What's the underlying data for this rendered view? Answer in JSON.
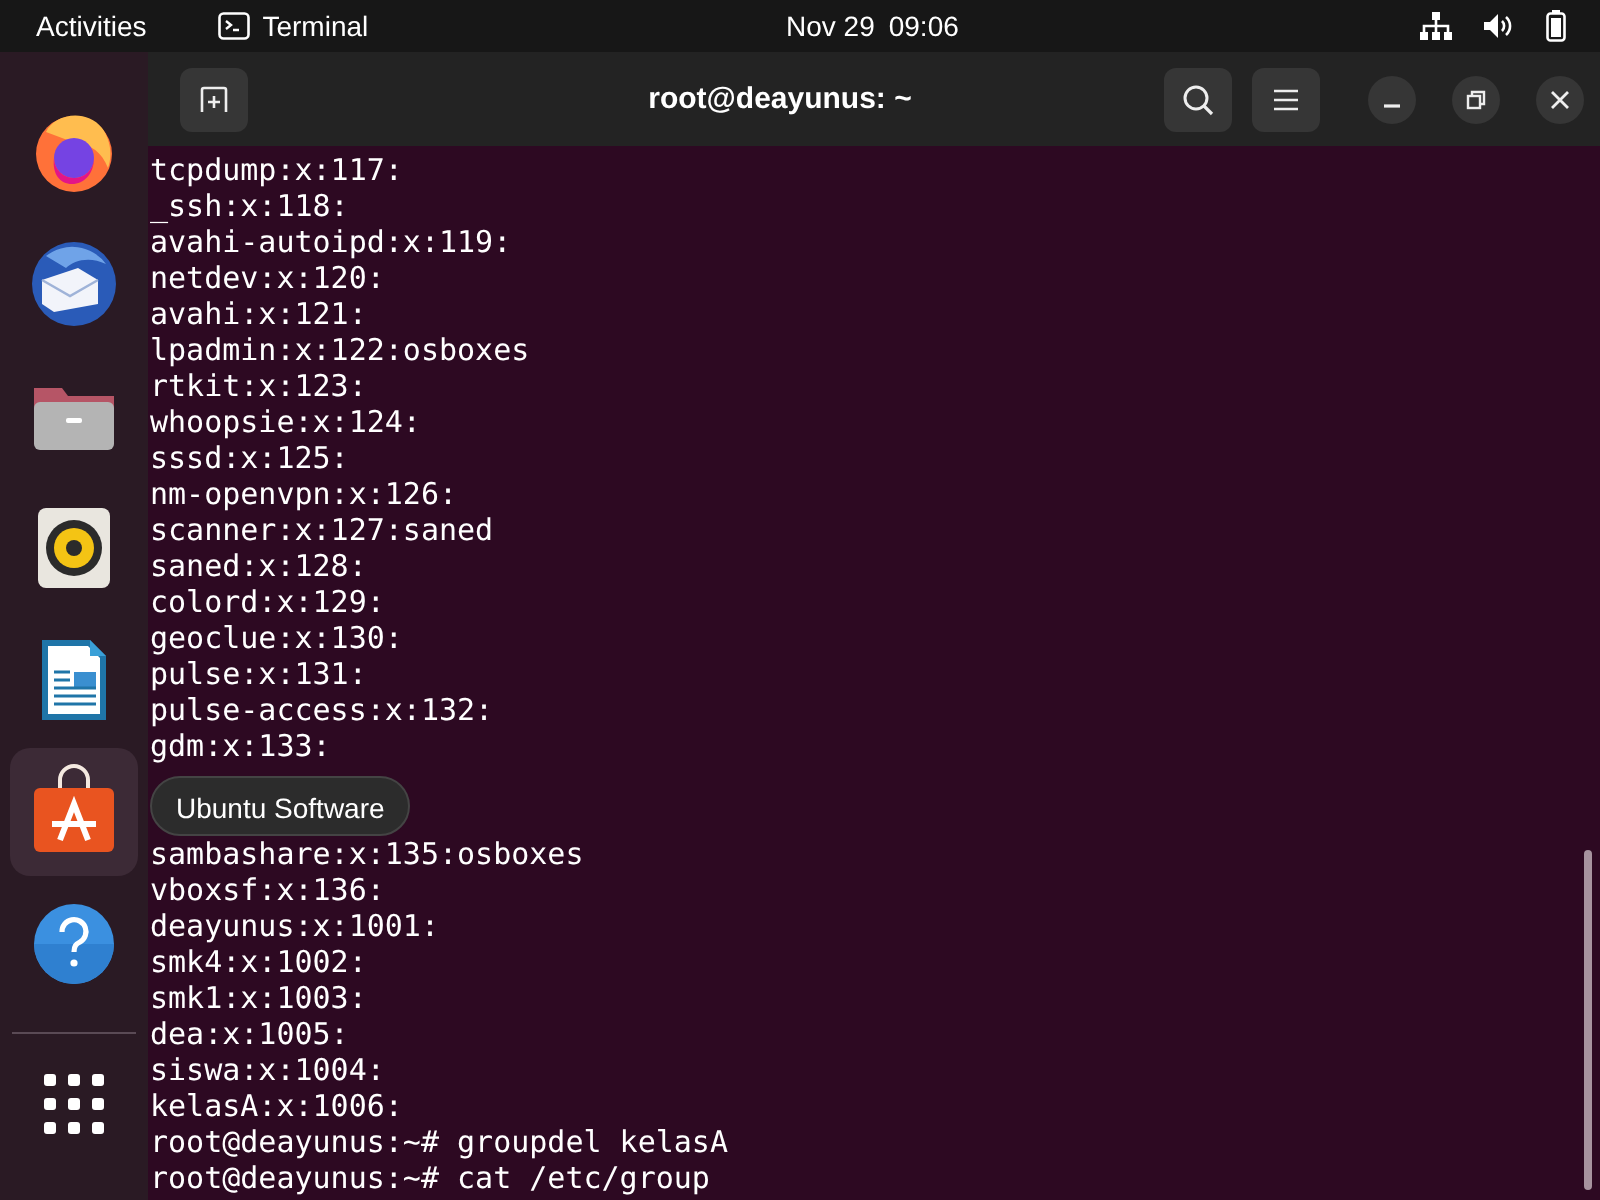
{
  "top_bar": {
    "activities": "Activities",
    "app_name": "Terminal",
    "date": "Nov 29",
    "time": "09:06"
  },
  "dock": {
    "items": [
      {
        "kind": "browser",
        "selected": false
      },
      {
        "kind": "mail",
        "selected": false
      },
      {
        "kind": "files",
        "selected": false
      },
      {
        "kind": "music",
        "selected": false
      },
      {
        "kind": "writer",
        "selected": false
      },
      {
        "kind": "store",
        "selected": true
      },
      {
        "kind": "help",
        "selected": false
      }
    ],
    "tooltip": "Ubuntu Software"
  },
  "window": {
    "title": "root@deayunus: ~"
  },
  "terminal": {
    "lines": [
      {
        "kind": "text",
        "text": "tcpdump:x:117:"
      },
      {
        "kind": "text",
        "text": "_ssh:x:118:"
      },
      {
        "kind": "text",
        "text": "avahi-autoipd:x:119:"
      },
      {
        "kind": "text",
        "text": "netdev:x:120:"
      },
      {
        "kind": "text",
        "text": "avahi:x:121:"
      },
      {
        "kind": "text",
        "text": "lpadmin:x:122:osboxes"
      },
      {
        "kind": "text",
        "text": "rtkit:x:123:"
      },
      {
        "kind": "text",
        "text": "whoopsie:x:124:"
      },
      {
        "kind": "text",
        "text": "sssd:x:125:"
      },
      {
        "kind": "text",
        "text": "nm-openvpn:x:126:"
      },
      {
        "kind": "text",
        "text": "scanner:x:127:saned"
      },
      {
        "kind": "text",
        "text": "saned:x:128:"
      },
      {
        "kind": "text",
        "text": "colord:x:129:"
      },
      {
        "kind": "text",
        "text": "geoclue:x:130:"
      },
      {
        "kind": "text",
        "text": "pulse:x:131:"
      },
      {
        "kind": "text",
        "text": "pulse-access:x:132:"
      },
      {
        "kind": "text",
        "text": "gdm:x:133:"
      },
      {
        "kind": "covered"
      },
      {
        "kind": "covered"
      },
      {
        "kind": "text",
        "text": "sambashare:x:135:osboxes"
      },
      {
        "kind": "text",
        "text": "vboxsf:x:136:"
      },
      {
        "kind": "text",
        "text": "deayunus:x:1001:"
      },
      {
        "kind": "text",
        "text": "smk4:x:1002:"
      },
      {
        "kind": "text",
        "text": "smk1:x:1003:"
      },
      {
        "kind": "text",
        "text": "dea:x:1005:"
      },
      {
        "kind": "text",
        "text": "siswa:x:1004:"
      },
      {
        "kind": "text",
        "text": "kelasA:x:1006:"
      },
      {
        "kind": "text",
        "text": "root@deayunus:~# groupdel kelasA"
      },
      {
        "kind": "text",
        "text": "root@deayunus:~# cat /etc/group"
      }
    ]
  }
}
